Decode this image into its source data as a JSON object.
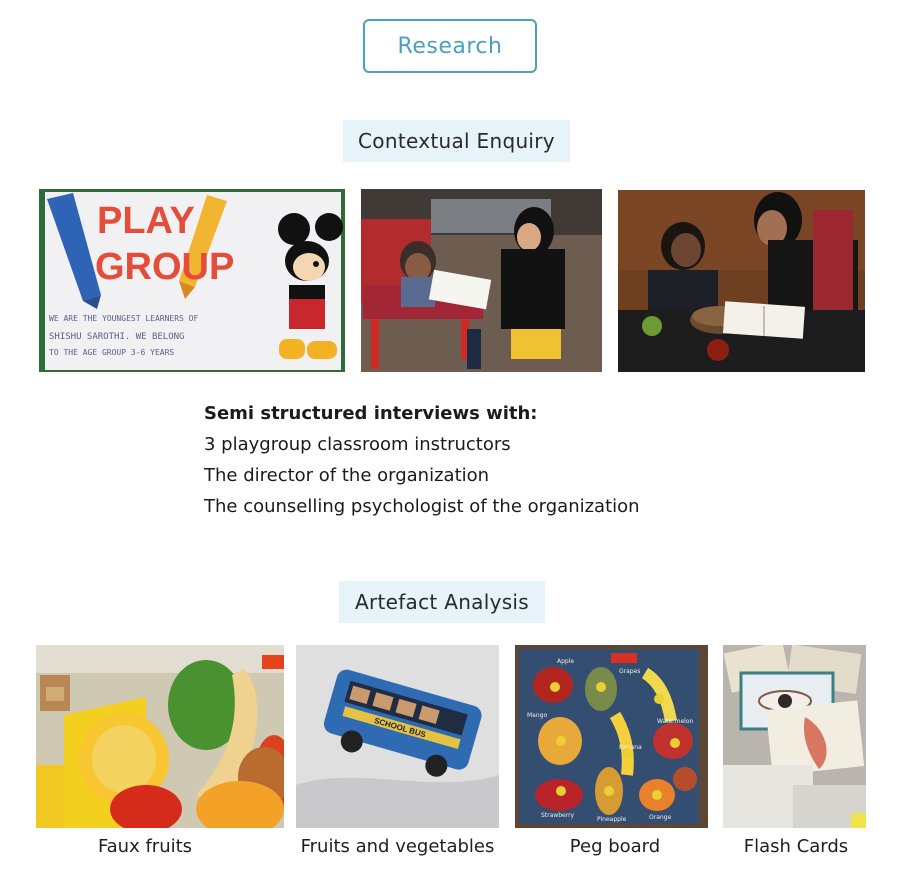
{
  "header": {
    "title": "Research"
  },
  "contextual": {
    "title": "Contextual Enquiry",
    "poster_text": {
      "line1": "PLAY",
      "line2": "GROUP",
      "line3": "WE ARE THE YOUNGEST LEARNERS OF",
      "line4": "SHISHU SAROTHI. WE BELONG",
      "line5": "TO THE AGE GROUP 3-6 YEARS"
    },
    "interviews_heading": "Semi structured interviews with:",
    "interviews": [
      "3 playgroup classroom instructors",
      "The director of the organization",
      "The counselling psychologist of the organization"
    ]
  },
  "artefact": {
    "title": "Artefact Analysis",
    "items": [
      {
        "caption": "Faux fruits"
      },
      {
        "caption": "Fruits and vegetables"
      },
      {
        "caption": "Peg board"
      },
      {
        "caption": "Flash Cards"
      }
    ],
    "bus_text": "SCHOOL BUS",
    "peg_labels": [
      "Apple",
      "Grapes",
      "Mango",
      "Banana",
      "Watermelon",
      "Strawberry",
      "Pineapple",
      "Orange"
    ]
  },
  "colors": {
    "accent": "#4aa0c2",
    "title_bg": "#e6f3f9"
  }
}
